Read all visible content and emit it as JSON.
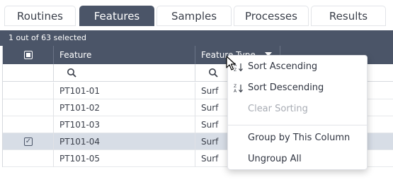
{
  "tabs": [
    {
      "label": "Routines",
      "active": false
    },
    {
      "label": "Features",
      "active": true
    },
    {
      "label": "Samples",
      "active": false
    },
    {
      "label": "Processes",
      "active": false
    },
    {
      "label": "Results",
      "active": false
    }
  ],
  "status": {
    "selection_text": "1 out of 63 selected"
  },
  "grid": {
    "columns": [
      {
        "label": "Feature"
      },
      {
        "label": "Feature Type"
      }
    ],
    "rows": [
      {
        "feature": "PT101-01",
        "type": "Surf",
        "selected": false
      },
      {
        "feature": "PT101-02",
        "type": "Surf",
        "selected": false
      },
      {
        "feature": "PT101-03",
        "type": "Surf",
        "selected": false
      },
      {
        "feature": "PT101-04",
        "type": "Surf",
        "selected": true,
        "check": "✓"
      },
      {
        "feature": "PT101-05",
        "type": "Surf",
        "selected": false
      }
    ]
  },
  "context_menu": {
    "sort_ascending": "Sort Ascending",
    "sort_descending": "Sort Descending",
    "clear_sorting": "Clear Sorting",
    "group_by_column": "Group by This Column",
    "ungroup_all": "Ungroup All"
  },
  "colors": {
    "accent": "#4b5568",
    "selected_row": "#d7dde6",
    "disabled_text": "#a8acb4"
  }
}
